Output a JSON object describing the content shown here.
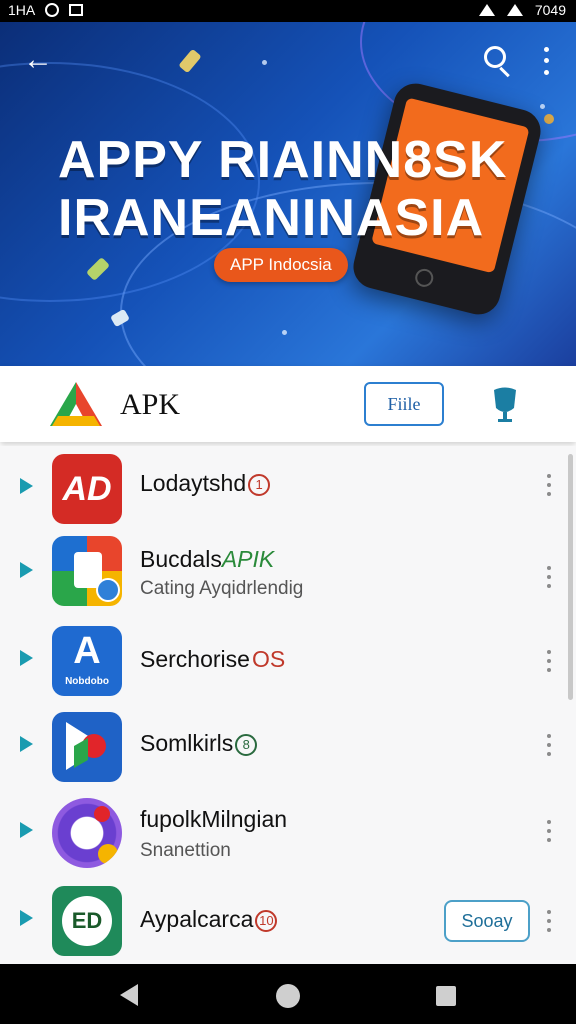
{
  "status_bar": {
    "left_text": "1HA",
    "right_text": "7049"
  },
  "banner": {
    "headline_line1": "APPY RIAINN8SK",
    "headline_line2": "IRANEANINASIA",
    "pill": "APP Indocsia",
    "back_icon": "arrow-left-icon",
    "search_icon": "search-icon",
    "more_icon": "more-vert-icon"
  },
  "toolbar": {
    "title": "APK",
    "file_button": "Fiile",
    "logo_icon": "apk-logo-icon",
    "mic_icon": "mic-icon"
  },
  "apps": [
    {
      "title": "Lodaytshd",
      "badge": "1",
      "subtitle": "",
      "icon_text": "AD",
      "icon": "app-icon-red",
      "badge_color": "#c0392b"
    },
    {
      "title": "Bucdals",
      "title_accent": "APIK",
      "badge": "",
      "subtitle": "Cating Ayqidrlendig",
      "icon_text": "",
      "icon": "app-icon-multicolor"
    },
    {
      "title": "Serchorise",
      "badge": "",
      "badge_text": "OS",
      "subtitle": "",
      "icon_text": "A",
      "icon_sub": "Nobdobo",
      "icon": "app-icon-blue",
      "badge_color": "#c0392b"
    },
    {
      "title": "Somlkirls",
      "badge": "8",
      "subtitle": "",
      "icon_text": "",
      "icon": "app-icon-play",
      "badge_color": "#2a6a3f"
    },
    {
      "title": "fupolkMilngian",
      "badge": "",
      "subtitle": "Snanettion",
      "icon_text": "",
      "icon": "app-icon-purple"
    },
    {
      "title": "Aypalcarca",
      "badge": "10",
      "subtitle": "",
      "icon_text": "ED",
      "icon": "app-icon-green",
      "badge_color": "#c0392b",
      "action": "Sooay"
    }
  ],
  "nav": {
    "back_icon": "nav-back-icon",
    "home_icon": "nav-home-icon",
    "recent_icon": "nav-recent-icon"
  }
}
